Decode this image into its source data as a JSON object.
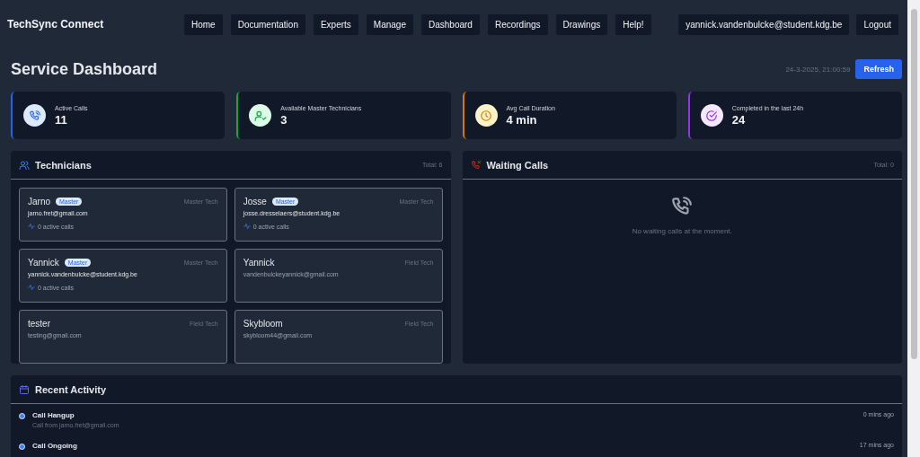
{
  "header": {
    "brand": "TechSync Connect",
    "nav": [
      {
        "label": "Home"
      },
      {
        "label": "Documentation"
      },
      {
        "label": "Experts"
      },
      {
        "label": "Manage"
      },
      {
        "label": "Dashboard"
      },
      {
        "label": "Recordings"
      },
      {
        "label": "Drawings"
      },
      {
        "label": "Help!"
      }
    ],
    "user": "yannick.vandenbulcke@student.kdg.be",
    "logout": "Logout"
  },
  "page": {
    "title": "Service Dashboard",
    "timestamp": "24-3-2025, 21:00:59",
    "refresh": "Refresh"
  },
  "stats": [
    {
      "kind": "phone",
      "label": "Active Calls",
      "value": "11",
      "color": "#2563eb"
    },
    {
      "kind": "user-check",
      "label": "Available Master Technicians",
      "value": "3",
      "color": "#16a34a"
    },
    {
      "kind": "clock",
      "label": "Avg Call Duration",
      "value": "4 min",
      "color": "#d97706"
    },
    {
      "kind": "check",
      "label": "Completed in the last 24h",
      "value": "24",
      "color": "#9333ea"
    }
  ],
  "technicians": {
    "title": "Technicians",
    "total": "Total: 6",
    "items": [
      {
        "name": "Jarno",
        "badge": "Master",
        "email": "jarno.fret@gmail.com",
        "role": "Master Tech",
        "activity": "0 active calls"
      },
      {
        "name": "Josse",
        "badge": "Master",
        "email": "josse.dresselaers@student.kdg.be",
        "role": "Master Tech",
        "activity": "0 active calls"
      },
      {
        "name": "Yannick",
        "badge": "Master",
        "email": "yannick.vandenbulcke@student.kdg.be",
        "role": "Master Tech",
        "activity": "0 active calls"
      },
      {
        "name": "Yannick",
        "email": "vandenbulckeyannick@gmail.com",
        "role": "Field Tech"
      },
      {
        "name": "tester",
        "email": "testing@gmail.com",
        "role": "Field Tech"
      },
      {
        "name": "Skybloom",
        "email": "skybloom44@gmail.com",
        "role": "Field Tech"
      }
    ]
  },
  "waiting_calls": {
    "title": "Waiting Calls",
    "total": "Total: 0",
    "empty_message": "No waiting calls at the moment."
  },
  "recent_activity": {
    "title": "Recent Activity",
    "items": [
      {
        "title": "Call Hangup",
        "detail": "Call from jarno.fret@gmail.com",
        "time": "0 mins ago"
      },
      {
        "title": "Call Ongoing",
        "time": "17 mins ago"
      }
    ]
  }
}
